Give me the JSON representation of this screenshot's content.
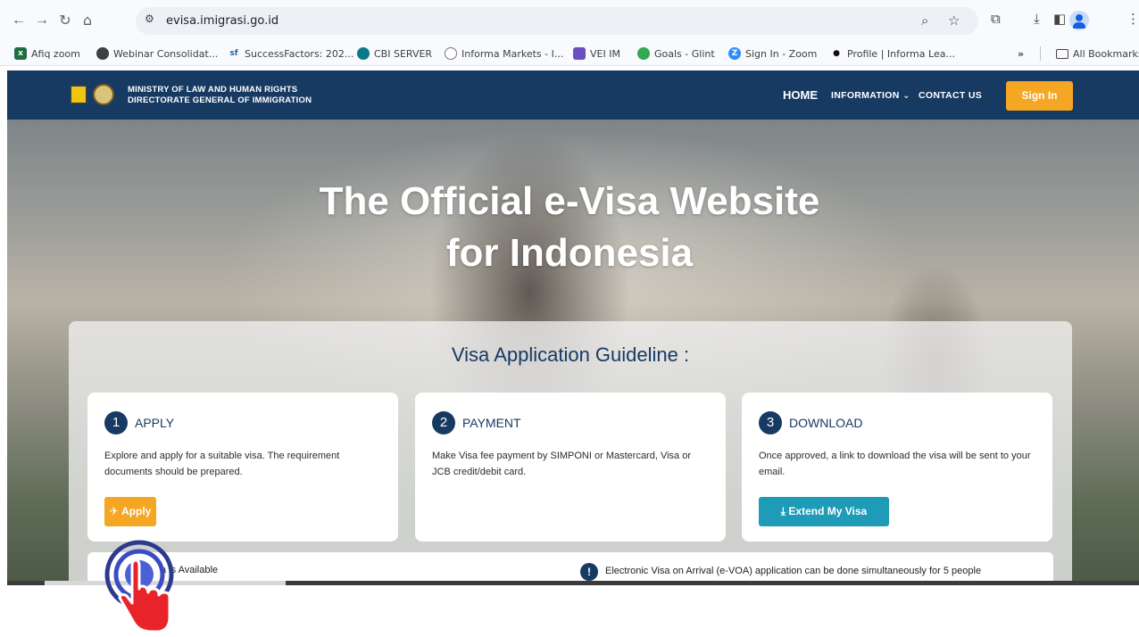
{
  "browser": {
    "url": "evisa.imigrasi.go.id",
    "bookmarks": [
      "Afiq zoom",
      "Webinar Consolidat...",
      "SuccessFactors: 202...",
      "CBI SERVER",
      "Informa Markets - I...",
      "VEI IM",
      "Goals - Glint",
      "Sign In - Zoom",
      "Profile | Informa Lea...",
      "All Bookmarks"
    ],
    "overflow_label": "»"
  },
  "site": {
    "ministry_line1": "MINISTRY OF LAW AND HUMAN RIGHTS",
    "ministry_line2": "DIRECTORATE GENERAL OF IMMIGRATION",
    "nav": {
      "home": "HOME",
      "information": "INFORMATION",
      "contact": "CONTACT US",
      "signin": "Sign In"
    },
    "hero": {
      "line1": "The Official e-Visa Website",
      "line2": "for Indonesia"
    },
    "guideline_title": "Visa Application Guideline :",
    "steps": [
      {
        "number": "1",
        "title": "APPLY",
        "description": "Explore and apply for a suitable visa. The requirement documents should be prepared.",
        "button": "Apply"
      },
      {
        "number": "2",
        "title": "PAYMENT",
        "description": "Make Visa fee payment by SIMPONI or Mastercard, Visa or JCB credit/debit card."
      },
      {
        "number": "3",
        "title": "DOWNLOAD",
        "description": "Once approved, a link to download the visa will be sent to your email.",
        "button": "Extend My Visa"
      }
    ],
    "notice_left": "a is Available",
    "notice_icon": "!",
    "notice_right": "Electronic Visa on Arrival (e-VOA) application can be done simultaneously for 5 people"
  }
}
